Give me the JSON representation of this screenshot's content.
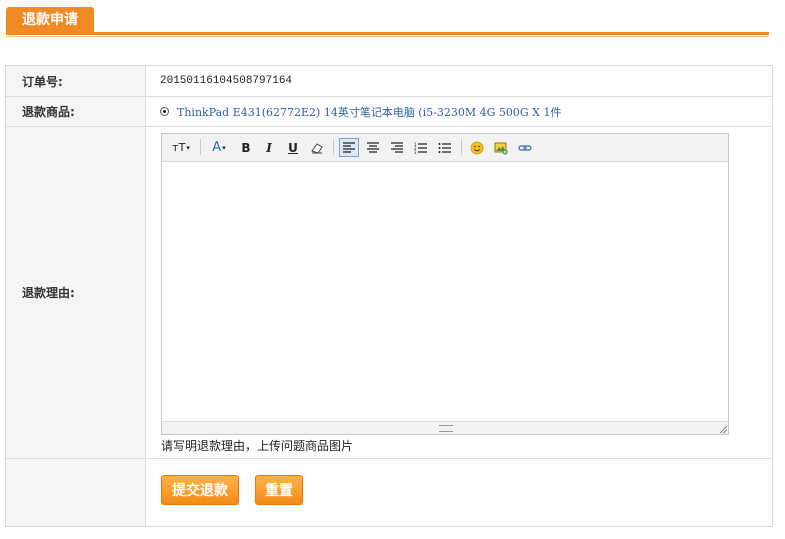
{
  "header": {
    "title": "退款申请"
  },
  "form": {
    "order_label": "订单号:",
    "order_value": "20150116104508797164",
    "product_label": "退款商品:",
    "product_value": "ThinkPad E431(62772E2) 14英寸笔记本电脑 (i5-3230M 4G 500G X 1件",
    "reason_label": "退款理由:",
    "hint": "请写明退款理由，上传问题商品图片"
  },
  "toolbar": {
    "font_size": "тT",
    "font_color": "A",
    "bold": "B",
    "italic": "I",
    "underline": "U"
  },
  "buttons": {
    "submit": "提交退款",
    "reset": "重置"
  },
  "colors": {
    "accent": "#f08a24",
    "link": "#2b5fa8"
  }
}
